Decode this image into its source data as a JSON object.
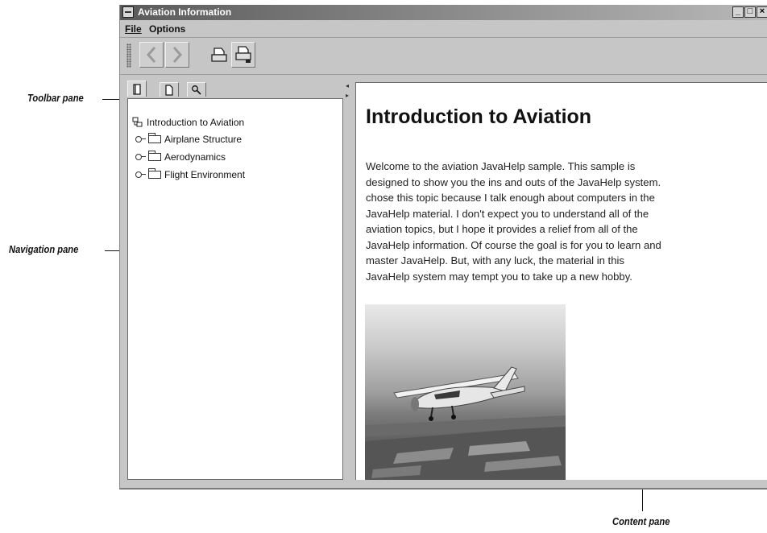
{
  "window": {
    "title": "Aviation Information",
    "controls": [
      "_",
      "□",
      "×"
    ]
  },
  "menu": {
    "items": [
      {
        "label": "File"
      },
      {
        "label": "Options"
      }
    ]
  },
  "toolbar": {
    "buttons": [
      {
        "icon": "back-arrow-icon"
      },
      {
        "icon": "forward-arrow-icon"
      },
      {
        "icon": "print-icon"
      },
      {
        "icon": "page-setup-icon"
      }
    ]
  },
  "navigator": {
    "tabs": [
      {
        "icon": "toc-icon",
        "active": true
      },
      {
        "icon": "index-icon",
        "active": false
      },
      {
        "icon": "search-icon",
        "active": false
      }
    ],
    "tree": [
      {
        "label": "Introduction to Aviation",
        "icon": "topic-icon"
      },
      {
        "label": "Airplane Structure",
        "icon": "folder-icon"
      },
      {
        "label": "Aerodynamics",
        "icon": "folder-icon"
      },
      {
        "label": "Flight Environment",
        "icon": "folder-icon"
      }
    ]
  },
  "content": {
    "title": "Introduction to Aviation",
    "lines": [
      "Welcome to the aviation JavaHelp sample. This sample is",
      "designed to show you the ins and outs of the JavaHelp system.",
      "chose this topic because I talk enough about computers in the",
      "JavaHelp material. I don't expect you to understand all of the",
      "aviation topics, but I hope it provides a relief from all of the",
      "JavaHelp information. Of course the goal is for you to learn and",
      "master JavaHelp. But, with any luck, the material in this",
      "JavaHelp system may tempt you to take up a new hobby."
    ],
    "image": "airplane-photo"
  },
  "callouts": {
    "toolbar_pane": "Toolbar pane",
    "navigation_pane": "Navigation pane",
    "content_pane": "Content pane"
  }
}
